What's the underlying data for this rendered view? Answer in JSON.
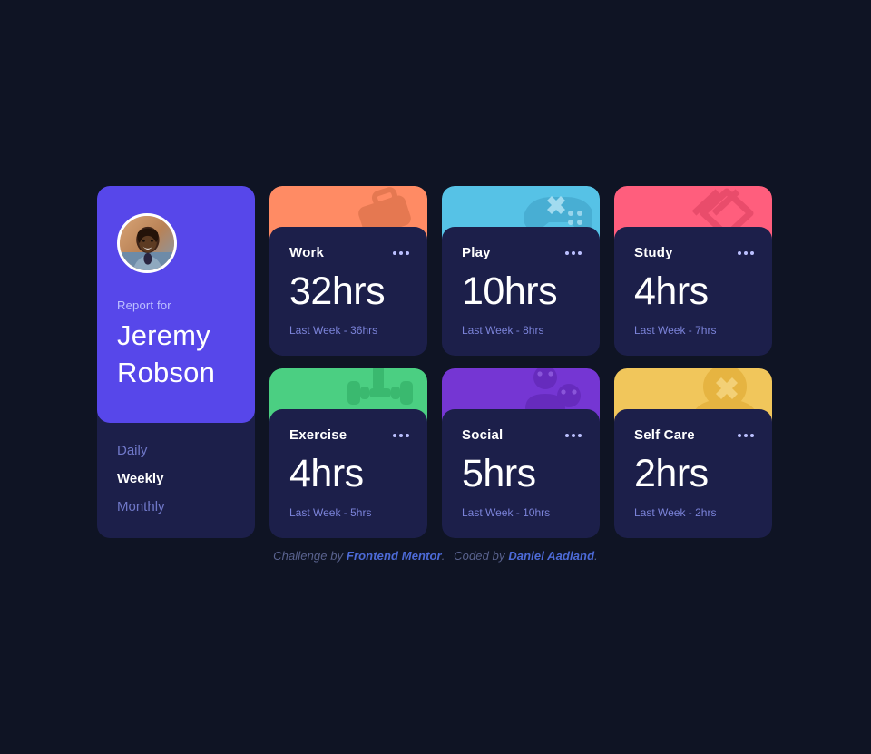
{
  "theme": {
    "page_background": "#0f1424",
    "card_background": "#1c1f4a",
    "profile_accent": "#5747ea",
    "text_primary": "#ffffff",
    "text_muted": "#7b83d9"
  },
  "profile": {
    "avatar_alt": "avatar",
    "report_label": "Report for",
    "name_line1": "Jeremy",
    "name_line2": "Robson",
    "periods": [
      {
        "label": "Daily",
        "active": false
      },
      {
        "label": "Weekly",
        "active": true
      },
      {
        "label": "Monthly",
        "active": false
      }
    ]
  },
  "cards": [
    {
      "title": "Work",
      "hours": "32hrs",
      "previous": "Last Week - 36hrs",
      "accent": "#ff8b64",
      "icon": "briefcase-icon"
    },
    {
      "title": "Play",
      "hours": "10hrs",
      "previous": "Last Week - 8hrs",
      "accent": "#56c2e6",
      "icon": "game-controller-icon"
    },
    {
      "title": "Study",
      "hours": "4hrs",
      "previous": "Last Week - 7hrs",
      "accent": "#ff5e7d",
      "icon": "book-icon"
    },
    {
      "title": "Exercise",
      "hours": "4hrs",
      "previous": "Last Week - 5hrs",
      "accent": "#4bcf82",
      "icon": "dumbbell-icon"
    },
    {
      "title": "Social",
      "hours": "5hrs",
      "previous": "Last Week - 10hrs",
      "accent": "#7536d3",
      "icon": "people-icon"
    },
    {
      "title": "Self Care",
      "hours": "2hrs",
      "previous": "Last Week - 2hrs",
      "accent": "#f1c65b",
      "icon": "meditation-icon"
    }
  ],
  "attribution": {
    "challenge_prefix": "Challenge by",
    "challenge_link": "Frontend Mentor",
    "challenge_suffix": ".",
    "coded_prefix": "Coded by",
    "coded_link": "Daniel Aadland",
    "coded_suffix": "."
  },
  "icons": {
    "menu": "ellipsis-icon"
  }
}
